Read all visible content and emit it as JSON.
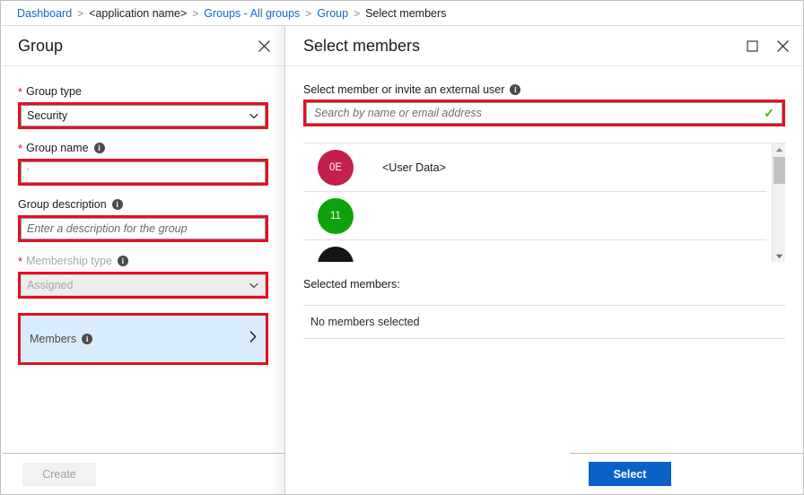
{
  "breadcrumb": {
    "items": [
      {
        "label": "Dashboard",
        "type": "link"
      },
      {
        "label": "<application name>",
        "type": "plain"
      },
      {
        "label": "Groups - All groups",
        "type": "link"
      },
      {
        "label": "Group",
        "type": "link"
      },
      {
        "label": "Select members",
        "type": "current"
      }
    ],
    "separator": ">"
  },
  "colors": {
    "link": "#1668c5",
    "annotation_red": "#e31022",
    "primary_button": "#0a62c9",
    "selected_row_bg": "#d9ecfb",
    "required_asterisk": "#e01020",
    "valid_check_green": "#4caf17",
    "avatar_1": "#c31f4f",
    "avatar_2": "#0ea30e",
    "avatar_3": "#151515"
  },
  "group_panel": {
    "title": "Group",
    "close_icon": "close-icon",
    "fields": {
      "group_type": {
        "label": "Group type",
        "required_marker": "*",
        "value": "Security",
        "caret_icon": "chevron-down-icon",
        "highlighted": true
      },
      "group_name": {
        "label": "Group name",
        "required_marker": "*",
        "info_icon": "info-icon",
        "value": "'",
        "placeholder": "",
        "highlighted": true
      },
      "group_description": {
        "label": "Group description",
        "info_icon": "info-icon",
        "value": "",
        "placeholder": "Enter a description for the group",
        "highlighted": true
      },
      "membership_type": {
        "label": "Membership type",
        "required_marker": "*",
        "info_icon": "info-icon",
        "value": "Assigned",
        "caret_icon": "chevron-down-icon",
        "disabled": true,
        "highlighted": true
      },
      "members": {
        "label": "Members",
        "info_icon": "info-icon",
        "chevron_icon": "chevron-right-icon",
        "selected": true,
        "highlighted": true
      }
    },
    "footer": {
      "create_label": "Create",
      "create_disabled": true
    }
  },
  "select_members_panel": {
    "title": "Select members",
    "maximize_icon": "maximize-icon",
    "close_icon": "close-icon",
    "search": {
      "label": "Select member or invite an external user",
      "info_icon": "info-icon",
      "value": "",
      "placeholder": "Search by name or email address",
      "valid_icon": "checkmark-icon",
      "highlighted": true
    },
    "user_list": {
      "rows": [
        {
          "initials": "0E",
          "avatar_color": "#c31f4f",
          "name": "<User Data>"
        },
        {
          "initials": "11",
          "avatar_color": "#0ea30e",
          "name": ""
        },
        {
          "initials": "",
          "avatar_color": "#151515",
          "name": ""
        }
      ],
      "scrollbar": {
        "up_icon": "scroll-up-arrow-icon",
        "down_icon": "scroll-down-arrow-icon",
        "thumb": "scrollbar-thumb"
      }
    },
    "selected_members": {
      "label": "Selected members:",
      "empty_text": "No members selected"
    },
    "footer": {
      "select_label": "Select"
    }
  }
}
